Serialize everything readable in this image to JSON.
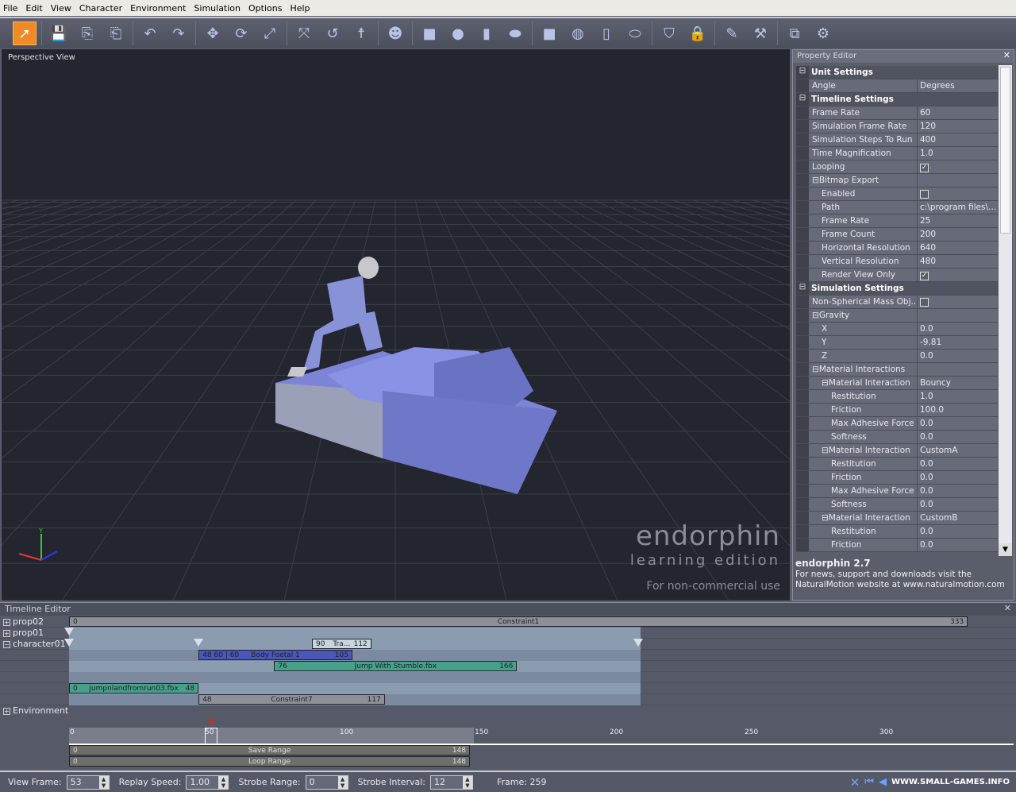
{
  "menu": [
    "File",
    "Edit",
    "View",
    "Character",
    "Environment",
    "Simulation",
    "Options",
    "Help"
  ],
  "toolbar": {
    "icons": [
      "select-arrow",
      "save",
      "import",
      "export",
      "undo",
      "redo",
      "move",
      "rotate",
      "scale",
      "ik-move",
      "ik-rotate",
      "character-pose",
      "head",
      "box",
      "sphere",
      "cylinder",
      "capsule",
      "cube-prop",
      "globe-prop",
      "cylinder-prop",
      "capsule-prop",
      "shield",
      "lock",
      "paint-brush",
      "axe",
      "resize-view",
      "settings"
    ]
  },
  "viewport": {
    "title": "Perspective View",
    "logo_main": "endorphin",
    "logo_sub": "learning edition",
    "logo_note": "For non-commercial use",
    "axis_y": "Y"
  },
  "property_editor": {
    "title": "Property Editor",
    "rows": [
      {
        "type": "section",
        "label": "Unit Settings"
      },
      {
        "label": "Angle",
        "value": "Degrees",
        "indent": 0
      },
      {
        "type": "section",
        "label": "Timeline Settings"
      },
      {
        "label": "Frame Rate",
        "value": "60",
        "indent": 0
      },
      {
        "label": "Simulation Frame Rate",
        "value": "120",
        "indent": 0
      },
      {
        "label": "Simulation Steps To Run",
        "value": "400",
        "indent": 0
      },
      {
        "label": "Time Magnification",
        "value": "1.0",
        "indent": 0
      },
      {
        "label": "Looping",
        "checked": true,
        "indent": 0
      },
      {
        "label": "Bitmap Export",
        "group": true,
        "indent": 0
      },
      {
        "label": "Enabled",
        "checked": false,
        "indent": 1
      },
      {
        "label": "Path",
        "value": "c:\\program files\\e...",
        "indent": 1
      },
      {
        "label": "Frame Rate",
        "value": "25",
        "indent": 1
      },
      {
        "label": "Frame Count",
        "value": "200",
        "indent": 1
      },
      {
        "label": "Horizontal Resolution",
        "value": "640",
        "indent": 1
      },
      {
        "label": "Vertical Resolution",
        "value": "480",
        "indent": 1
      },
      {
        "label": "Render View Only",
        "checked": true,
        "indent": 1
      },
      {
        "type": "section",
        "label": "Simulation Settings"
      },
      {
        "label": "Non-Spherical Mass Obj...",
        "checked": false,
        "indent": 0
      },
      {
        "label": "Gravity",
        "group": true,
        "indent": 0
      },
      {
        "label": "X",
        "value": "0.0",
        "indent": 1
      },
      {
        "label": "Y",
        "value": "-9.81",
        "indent": 1
      },
      {
        "label": "Z",
        "value": "0.0",
        "indent": 1
      },
      {
        "label": "Material Interactions",
        "group": true,
        "indent": 0
      },
      {
        "label": "Material Interaction",
        "value": "Bouncy",
        "group": true,
        "indent": 1
      },
      {
        "label": "Restitution",
        "value": "1.0",
        "indent": 2
      },
      {
        "label": "Friction",
        "value": "100.0",
        "indent": 2
      },
      {
        "label": "Max Adhesive Force",
        "value": "0.0",
        "indent": 2
      },
      {
        "label": "Softness",
        "value": "0.0",
        "indent": 2
      },
      {
        "label": "Material Interaction",
        "value": "CustomA",
        "group": true,
        "indent": 1
      },
      {
        "label": "Restitution",
        "value": "0.0",
        "indent": 2
      },
      {
        "label": "Friction",
        "value": "0.0",
        "indent": 2
      },
      {
        "label": "Max Adhesive Force",
        "value": "0.0",
        "indent": 2
      },
      {
        "label": "Softness",
        "value": "0.0",
        "indent": 2
      },
      {
        "label": "Material Interaction",
        "value": "CustomB",
        "group": true,
        "indent": 1
      },
      {
        "label": "Restitution",
        "value": "0.0",
        "indent": 2
      },
      {
        "label": "Friction",
        "value": "0.0",
        "indent": 2
      }
    ],
    "info_title": "endorphin 2.7",
    "info_text1": "For news, support and downloads visit the",
    "info_text2": "NaturalMotion website at www.naturalmotion.com"
  },
  "timeline": {
    "title": "Timeline Editor",
    "tracks": [
      {
        "name": "prop02",
        "expanded": false
      },
      {
        "name": "prop01",
        "expanded": false
      },
      {
        "name": "character01",
        "expanded": true
      },
      {
        "name": "Environment",
        "expanded": false
      }
    ],
    "clips": [
      {
        "row": 0,
        "start": 0,
        "end": 333,
        "label": "Constraint1",
        "start_label": "0",
        "end_label": "333",
        "color": "#8e9099"
      },
      {
        "row": 2,
        "start": 90,
        "end": 112,
        "label": "Tra...",
        "start_label": "90",
        "end_label": "112",
        "color": "#c8d4de"
      },
      {
        "row": 3,
        "start": 48,
        "end": 105,
        "label": "Body Foetal 1",
        "start_label": "48  60 | 60",
        "end_label": "105",
        "color": "#4a56b8"
      },
      {
        "row": 4,
        "start": 76,
        "end": 166,
        "label": "Jump With Stumble.fbx",
        "start_label": "76",
        "end_label": "166",
        "color": "#47a08a"
      },
      {
        "row": 6,
        "start": 0,
        "end": 48,
        "label": "jumpnlandfromrun03.fbx",
        "start_label": "0",
        "end_label": "48",
        "color": "#47a08a"
      },
      {
        "row": 7,
        "start": 48,
        "end": 117,
        "label": "Constraint7",
        "start_label": "48",
        "end_label": "117",
        "color": "#8e9099"
      }
    ],
    "ruler_ticks": [
      "0",
      "50",
      "100",
      "150",
      "200",
      "250",
      "300"
    ],
    "current_frame": 53,
    "save_range": {
      "label": "Save Range",
      "start": "0",
      "end": "148"
    },
    "loop_range": {
      "label": "Loop Range",
      "start": "0",
      "end": "148"
    }
  },
  "status": {
    "view_frame_label": "View Frame:",
    "view_frame": "53",
    "replay_speed_label": "Replay Speed:",
    "replay_speed": "1.00",
    "strobe_range_label": "Strobe Range:",
    "strobe_range": "0",
    "strobe_interval_label": "Strobe Interval:",
    "strobe_interval": "12",
    "frame_text": "Frame: 259",
    "watermark": "WWW.SMALL-GAMES.INFO"
  }
}
